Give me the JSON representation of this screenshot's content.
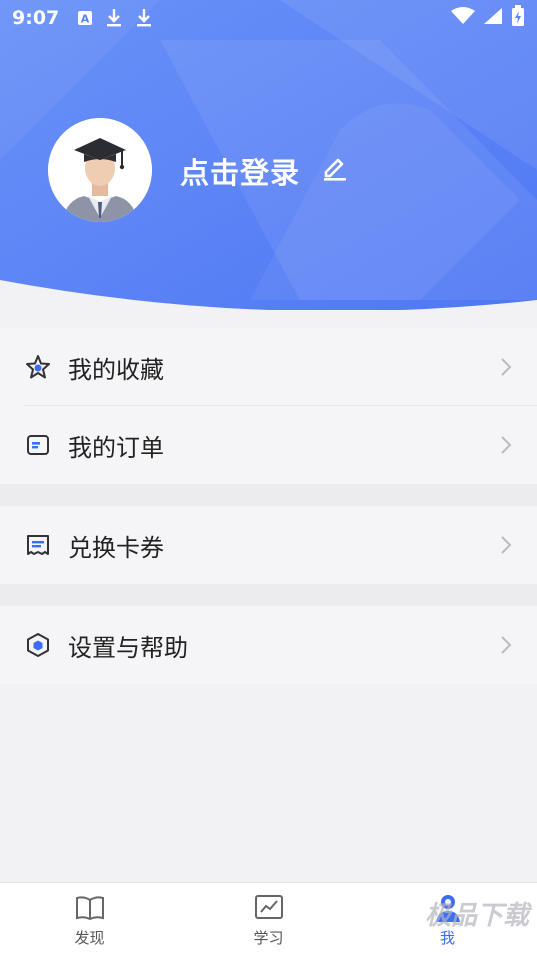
{
  "status_bar": {
    "time": "9:07",
    "icons": [
      "notification-a-icon",
      "download-icon",
      "download-icon",
      "wifi-icon",
      "signal-icon",
      "battery-charging-icon"
    ]
  },
  "profile": {
    "login_label": "点击登录",
    "avatar": "graduate-avatar",
    "edit_icon": "edit-icon"
  },
  "menu": {
    "favorites": {
      "label": "我的收藏",
      "icon": "star-icon"
    },
    "orders": {
      "label": "我的订单",
      "icon": "order-icon"
    },
    "redeem": {
      "label": "兑换卡券",
      "icon": "ticket-icon"
    },
    "settings": {
      "label": "设置与帮助",
      "icon": "hexagon-icon"
    }
  },
  "bottom_nav": {
    "discover": {
      "label": "发现",
      "icon": "book-icon"
    },
    "study": {
      "label": "学习",
      "icon": "chart-icon"
    },
    "me": {
      "label": "我",
      "icon": "user-icon",
      "active": true
    }
  },
  "watermark": "极品下载",
  "colors": {
    "hero_start": "#5b86f7",
    "hero_end": "#4a73f3",
    "accent": "#3d6cf5",
    "background": "#f5f5f7"
  }
}
